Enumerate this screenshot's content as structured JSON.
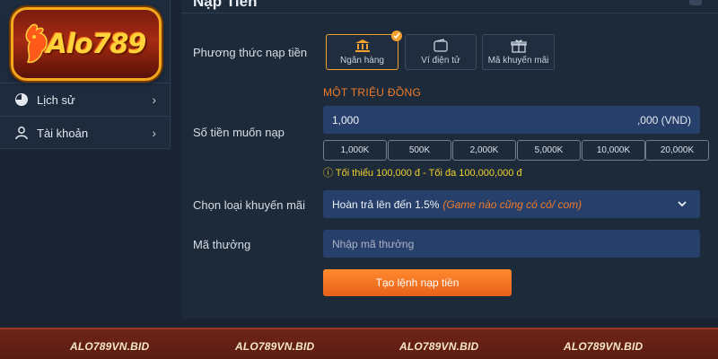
{
  "sidebar": {
    "logo_text": "Alo789",
    "items": [
      {
        "label": "Lịch sử",
        "icon": "history-icon"
      },
      {
        "label": "Tài khoản",
        "icon": "user-icon"
      }
    ]
  },
  "panel": {
    "title": "Nạp Tiền"
  },
  "deposit_form": {
    "method_label": "Phương thức nạp tiền",
    "methods": [
      {
        "label": "Ngân hàng",
        "icon": "bank-icon",
        "selected": true
      },
      {
        "label": "Ví điện tử",
        "icon": "wallet-icon",
        "selected": false
      },
      {
        "label": "Mã khuyến mãi",
        "icon": "gift-icon",
        "selected": false
      }
    ],
    "amount_label": "Số tiền muốn nạp",
    "amount_words": "MỘT TRIỆU ĐỒNG",
    "amount_value": "1,000",
    "amount_suffix": ",000 (VND)",
    "presets": [
      "1,000K",
      "500K",
      "2,000K",
      "5,000K",
      "10,000K",
      "20,000K"
    ],
    "limit_note": "Tối thiểu 100,000 đ - Tối đa 100,000,000 đ",
    "promo_label": "Chọn loại khuyến mãi",
    "promo_value": "Hoàn trả lên đến 1.5%",
    "promo_hint": "(Game nào cũng có cỏ/ com)",
    "code_label": "Mã thưởng",
    "code_placeholder": "Nhập mã thưởng",
    "submit_label": "Tạo lệnh nạp tiền"
  },
  "footer": {
    "links": [
      "ALO789VN.BID",
      "ALO789VN.BID",
      "ALO789VN.BID",
      "ALO789VN.BID"
    ]
  },
  "colors": {
    "accent": "#f2a12e",
    "button": "#ff7a24",
    "field_bg": "#27406b",
    "warning": "#f2d12a"
  }
}
